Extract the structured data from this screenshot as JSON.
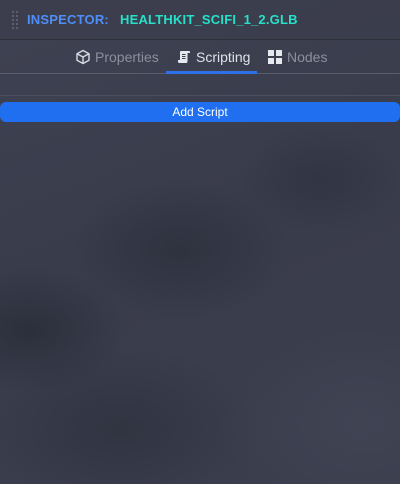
{
  "header": {
    "inspector_label": "INSPECTOR:",
    "file_name": "HEALTHKIT_SCIFI_1_2.GLB"
  },
  "tabs": [
    {
      "label": "Properties",
      "icon": "cube-icon",
      "active": false
    },
    {
      "label": "Scripting",
      "icon": "scroll-icon",
      "active": true
    },
    {
      "label": "Nodes",
      "icon": "grid-icon",
      "active": false
    }
  ],
  "scripting": {
    "add_script_label": "Add Script"
  },
  "colors": {
    "inspector_label": "#4f8ef7",
    "file_name": "#27e0c9",
    "accent": "#1f6ff0"
  }
}
